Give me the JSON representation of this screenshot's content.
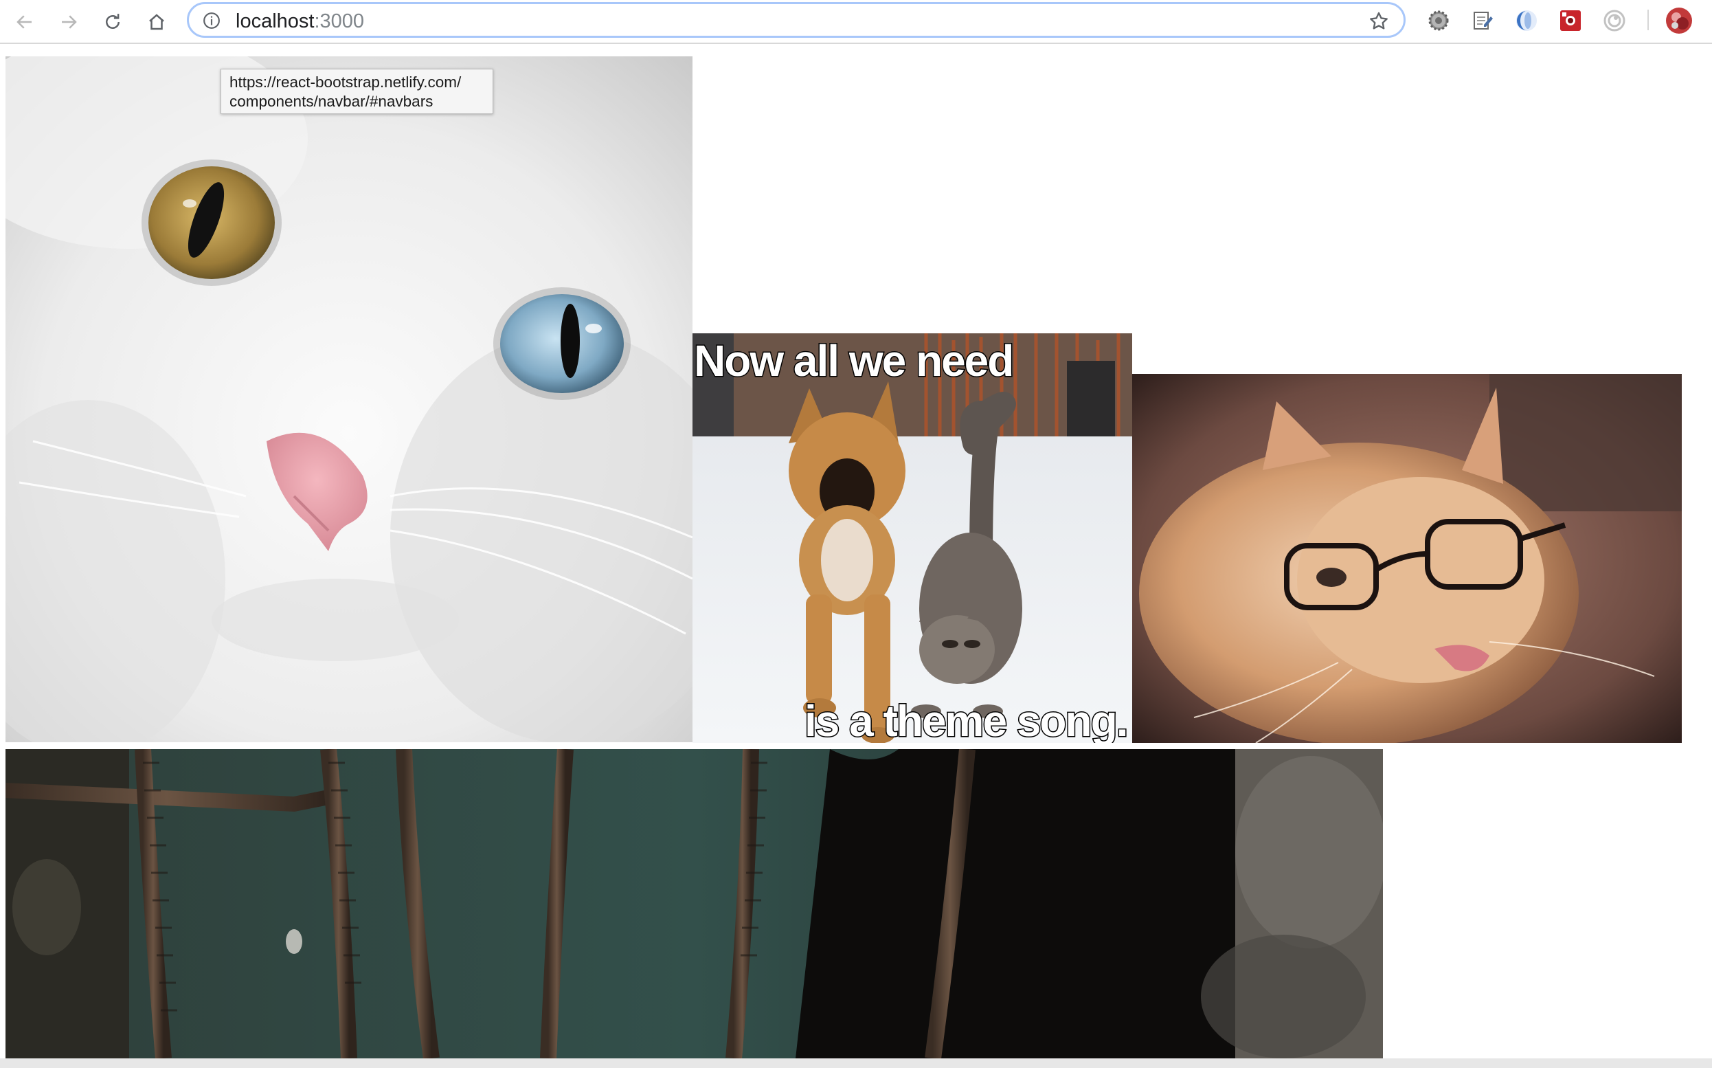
{
  "browser": {
    "address_bar": {
      "host": "localhost",
      "port": ":3000"
    },
    "icons": {
      "back": "arrow-left-icon",
      "forward": "arrow-right-icon",
      "reload": "reload-icon",
      "home": "home-icon",
      "site_info": "info-icon",
      "bookmark": "star-icon"
    },
    "extensions": [
      "gear-extension-icon",
      "notepad-extension-icon",
      "blue-circle-extension-icon",
      "red-square-extension-icon",
      "circle-record-extension-icon",
      "profile-avatar-icon"
    ]
  },
  "tooltip": {
    "line1": "https://react-bootstrap.netlify.com/",
    "line2": "components/navbar/#navbars"
  },
  "gallery": {
    "images": [
      {
        "subject": "white cat with heterochromatic eyes"
      },
      {
        "subject": "puppy and cat walking in snow",
        "caption_top": "Now all we need",
        "caption_bottom": "is a theme song."
      },
      {
        "subject": "ginger cat wearing glasses"
      },
      {
        "subject": "dark rusty bars and tunnel"
      }
    ]
  }
}
